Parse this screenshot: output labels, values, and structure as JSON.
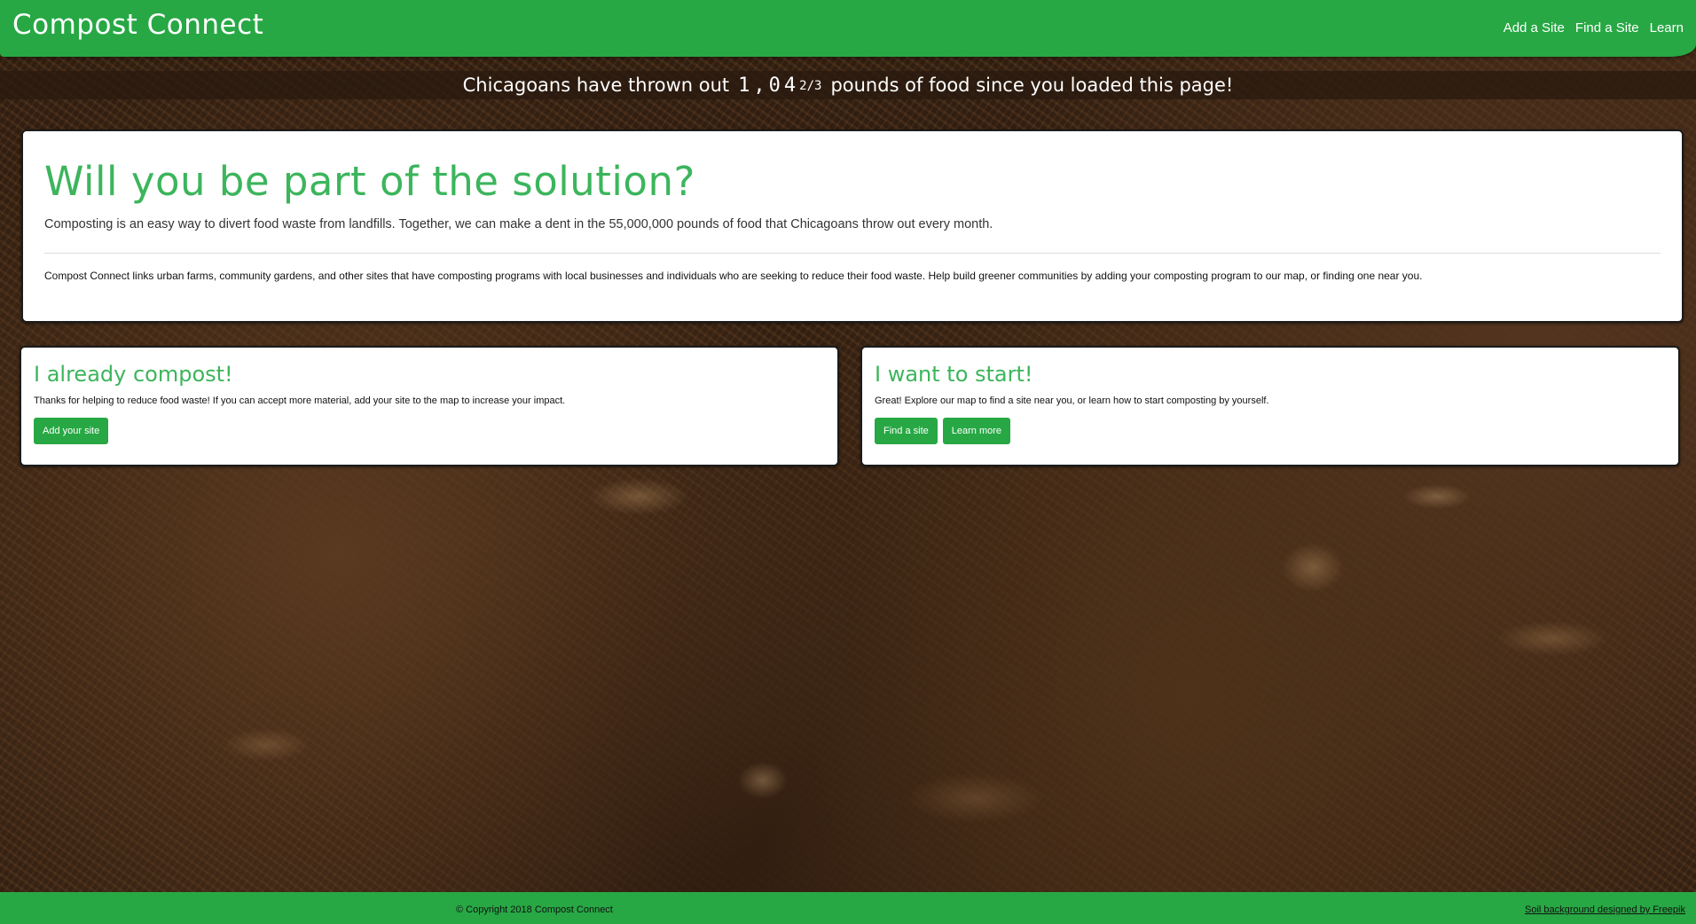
{
  "header": {
    "brand": "Compost Connect",
    "nav": [
      "Add a Site",
      "Find a Site",
      "Learn"
    ]
  },
  "ticker": {
    "prefix": "Chicagoans have thrown out",
    "counter": "1,04",
    "counter_rolling_digits": "2/3",
    "suffix": "pounds of food since you loaded this page!"
  },
  "hero": {
    "title": "Will you be part of the solution?",
    "lead": "Composting is an easy way to divert food waste from landfills. Together, we can make a dent in the 55,000,000 pounds of food that Chicagoans throw out every month.",
    "description": "Compost Connect links urban farms, community gardens, and other sites that have composting programs with local businesses and individuals who are seeking to reduce their food waste. Help build greener communities by adding your composting program to our map, or finding one near you."
  },
  "cards": {
    "left": {
      "title": "I already compost!",
      "text": "Thanks for helping to reduce food waste! If you can accept more material, add your site to the map to increase your impact.",
      "button": "Add your site"
    },
    "right": {
      "title": "I want to start!",
      "text": "Great! Explore our map to find a site near you, or learn how to start composting by yourself.",
      "buttons": [
        "Find a site",
        "Learn more"
      ]
    }
  },
  "footer": {
    "copyright": "© Copyright 2018 Compost Connect",
    "credit": "Soil background designed by Freepik"
  },
  "colors": {
    "primary_green": "#27a844",
    "heading_green": "#3cb55c"
  }
}
